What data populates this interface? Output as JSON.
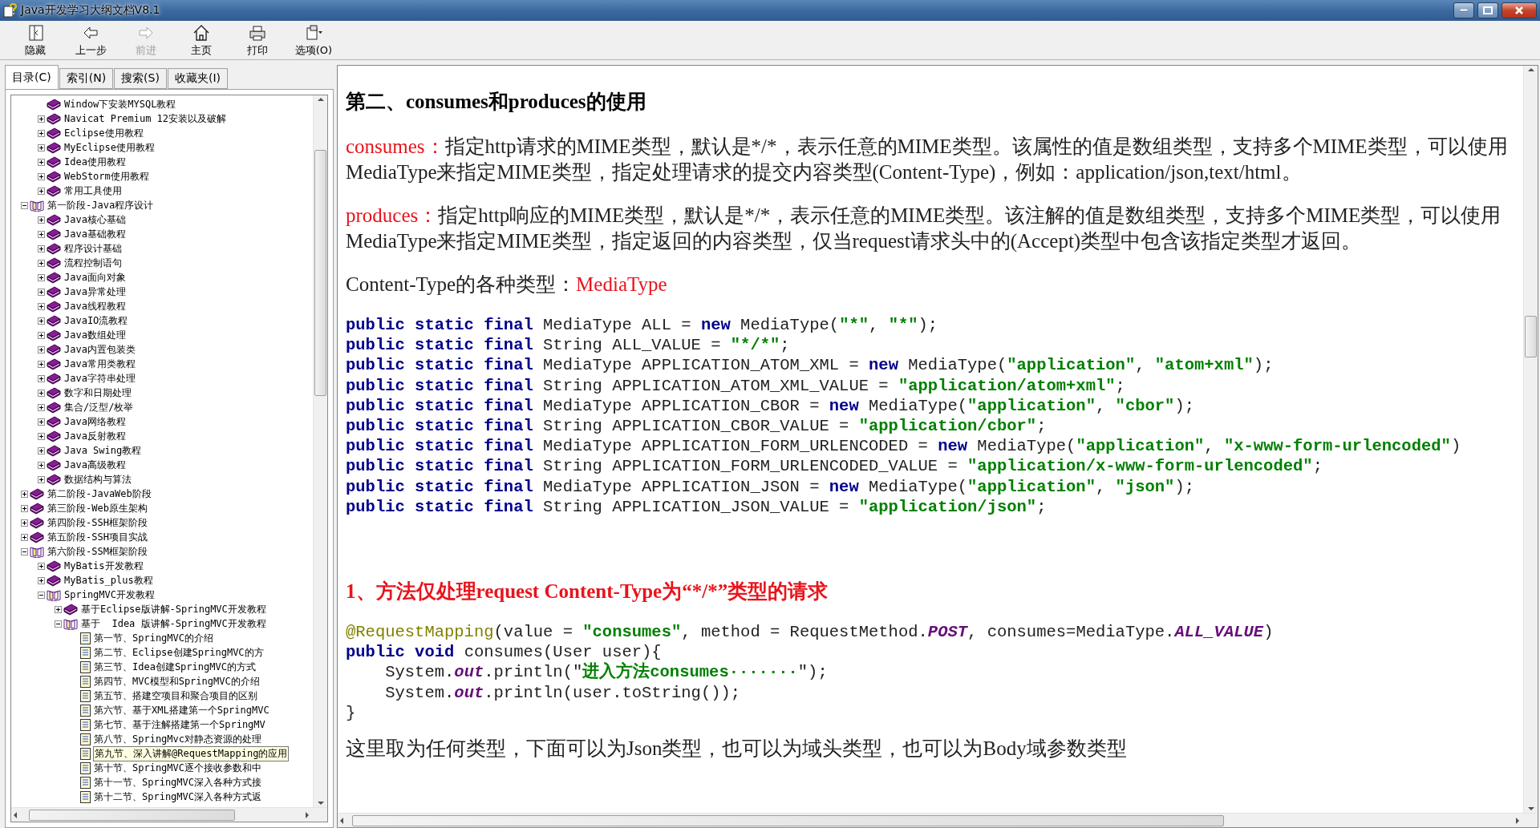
{
  "window": {
    "title": "Java开发学习大纲文档V8.1"
  },
  "toolbar": [
    {
      "label": "隐藏",
      "kind": "hide",
      "disabled": false
    },
    {
      "label": "上一步",
      "kind": "back",
      "disabled": false
    },
    {
      "label": "前进",
      "kind": "forward",
      "disabled": true
    },
    {
      "label": "主页",
      "kind": "home",
      "disabled": false
    },
    {
      "label": "打印",
      "kind": "print",
      "disabled": false
    },
    {
      "label": "选项(O)",
      "kind": "options",
      "disabled": false
    }
  ],
  "tabs": [
    {
      "label": "目录(C)",
      "selected": true
    },
    {
      "label": "索引(N)",
      "selected": false
    },
    {
      "label": "搜索(S)",
      "selected": false
    },
    {
      "label": "收藏夹(I)",
      "selected": false
    }
  ],
  "tree": [
    {
      "kind": "hidden",
      "children": [
        {
          "label": "Window下安装MYSQL教程",
          "kind": "book-single",
          "selected": false
        },
        {
          "label": "Navicat Premium 12安装以及破解",
          "kind": "book",
          "expanded": false,
          "selected": false
        },
        {
          "label": "Eclipse使用教程",
          "kind": "book",
          "expanded": false,
          "selected": false
        },
        {
          "label": "MyEclipse使用教程",
          "kind": "book",
          "expanded": false,
          "selected": false
        },
        {
          "label": "Idea使用教程",
          "kind": "book",
          "expanded": false,
          "selected": false
        },
        {
          "label": "WebStorm使用教程",
          "kind": "book",
          "expanded": false,
          "selected": false
        },
        {
          "label": "常用工具使用",
          "kind": "book",
          "expanded": false,
          "selected": false
        }
      ]
    },
    {
      "label": "第一阶段-Java程序设计",
      "kind": "book",
      "expanded": true,
      "selected": false,
      "children": [
        {
          "label": "Java核心基础",
          "kind": "book",
          "expanded": false,
          "selected": false
        },
        {
          "label": "Java基础教程",
          "kind": "book",
          "expanded": false,
          "selected": false
        },
        {
          "label": "程序设计基础",
          "kind": "book",
          "expanded": false,
          "selected": false
        },
        {
          "label": "流程控制语句",
          "kind": "book",
          "expanded": false,
          "selected": false
        },
        {
          "label": "Java面向对象",
          "kind": "book",
          "expanded": false,
          "selected": false
        },
        {
          "label": "Java异常处理",
          "kind": "book",
          "expanded": false,
          "selected": false
        },
        {
          "label": "Java线程教程",
          "kind": "book",
          "expanded": false,
          "selected": false
        },
        {
          "label": "JavaIO流教程",
          "kind": "book",
          "expanded": false,
          "selected": false
        },
        {
          "label": "Java数组处理",
          "kind": "book",
          "expanded": false,
          "selected": false
        },
        {
          "label": "Java内置包装类",
          "kind": "book",
          "expanded": false,
          "selected": false
        },
        {
          "label": "Java常用类教程",
          "kind": "book",
          "expanded": false,
          "selected": false
        },
        {
          "label": "Java字符串处理",
          "kind": "book",
          "expanded": false,
          "selected": false
        },
        {
          "label": "数字和日期处理",
          "kind": "book",
          "expanded": false,
          "selected": false
        },
        {
          "label": "集合/泛型/枚举",
          "kind": "book",
          "expanded": false,
          "selected": false
        },
        {
          "label": "Java网络教程",
          "kind": "book",
          "expanded": false,
          "selected": false
        },
        {
          "label": "Java反射教程",
          "kind": "book",
          "expanded": false,
          "selected": false
        },
        {
          "label": "Java Swing教程",
          "kind": "book",
          "expanded": false,
          "selected": false
        },
        {
          "label": "Java高级教程",
          "kind": "book",
          "expanded": false,
          "selected": false
        },
        {
          "label": "数据结构与算法",
          "kind": "book",
          "expanded": false,
          "selected": false
        }
      ]
    },
    {
      "label": "第二阶段-JavaWeb阶段",
      "kind": "book",
      "expanded": false,
      "selected": false
    },
    {
      "label": "第三阶段-Web原生架构",
      "kind": "book",
      "expanded": false,
      "selected": false
    },
    {
      "label": "第四阶段-SSH框架阶段",
      "kind": "book",
      "expanded": false,
      "selected": false
    },
    {
      "label": "第五阶段-SSH项目实战",
      "kind": "book",
      "expanded": false,
      "selected": false
    },
    {
      "label": "第六阶段-SSM框架阶段",
      "kind": "book",
      "expanded": true,
      "selected": false,
      "children": [
        {
          "label": "MyBatis开发教程",
          "kind": "book",
          "expanded": false,
          "selected": false
        },
        {
          "label": "MyBatis_plus教程",
          "kind": "book",
          "expanded": false,
          "selected": false
        },
        {
          "label": "SpringMVC开发教程",
          "kind": "book",
          "expanded": true,
          "selected": false,
          "children": [
            {
              "label": "基于Eclipse版讲解-SpringMVC开发教程",
              "kind": "book",
              "expanded": false,
              "selected": false
            },
            {
              "label": "基于  Idea 版讲解-SpringMVC开发教程",
              "kind": "book",
              "expanded": true,
              "selected": false,
              "children": [
                {
                  "label": "第一节、SpringMVC的介绍",
                  "kind": "page",
                  "selected": false
                },
                {
                  "label": "第二节、Eclipse创建SpringMVC的方",
                  "kind": "page",
                  "selected": false
                },
                {
                  "label": "第三节、Idea创建SpringMVC的方式",
                  "kind": "page",
                  "selected": false
                },
                {
                  "label": "第四节、MVC模型和SpringMVC的介绍",
                  "kind": "page",
                  "selected": false
                },
                {
                  "label": "第五节、搭建空项目和聚合项目的区别",
                  "kind": "page",
                  "selected": false
                },
                {
                  "label": "第六节、基于XML搭建第一个SpringMVC",
                  "kind": "page",
                  "selected": false
                },
                {
                  "label": "第七节、基于注解搭建第一个SpringMV",
                  "kind": "page",
                  "selected": false
                },
                {
                  "label": "第八节、SpringMvc对静态资源的处理",
                  "kind": "page",
                  "selected": false
                },
                {
                  "label": "第九节、深入讲解@RequestMapping的应用",
                  "kind": "page",
                  "selected": true
                },
                {
                  "label": "第十节、SpringMVC逐个接收参数和中",
                  "kind": "page",
                  "selected": false
                },
                {
                  "label": "第十一节、SpringMVC深入各种方式接",
                  "kind": "page",
                  "selected": false
                },
                {
                  "label": "第十二节、SpringMVC深入各种方式返",
                  "kind": "page",
                  "selected": false
                }
              ]
            }
          ]
        }
      ]
    }
  ],
  "content": [
    {
      "kind": "heading",
      "segments": [
        {
          "kind": "plain",
          "text": "第二、consumes和produces的使用"
        }
      ]
    },
    {
      "kind": "paragraph",
      "segments": [
        {
          "kind": "term",
          "text": "consumes："
        },
        {
          "kind": "plain",
          "text": "指定http请求的MIME类型，默认是*/*，表示任意的MIME类型。该属性的值是数组类型，支持多个MIME类型，可以使用MediaType来指定MIME类型，指定处理请求的提交内容类型(Content-Type)，例如：application/json,text/html。"
        }
      ]
    },
    {
      "kind": "paragraph",
      "segments": [
        {
          "kind": "term",
          "text": "produces："
        },
        {
          "kind": "plain",
          "text": "指定http响应的MIME类型，默认是*/*，表示任意的MIME类型。该注解的值是数组类型，支持多个MIME类型，可以使用MediaType来指定MIME类型，指定返回的内容类型，仅当request请求头中的(Accept)类型中包含该指定类型才返回。"
        }
      ]
    },
    {
      "kind": "paragraph",
      "segments": [
        {
          "kind": "plain",
          "text": "Content-Type的各种类型："
        },
        {
          "kind": "term",
          "text": "MediaType"
        }
      ]
    },
    {
      "kind": "code",
      "lines": [
        [
          {
            "kind": "kw",
            "text": "public static final"
          },
          {
            "kind": "plain",
            "text": " MediaType ALL = "
          },
          {
            "kind": "kw",
            "text": "new"
          },
          {
            "kind": "plain",
            "text": " MediaType("
          },
          {
            "kind": "str",
            "text": "\"*\""
          },
          {
            "kind": "plain",
            "text": ", "
          },
          {
            "kind": "str",
            "text": "\"*\""
          },
          {
            "kind": "plain",
            "text": ");"
          }
        ],
        [
          {
            "kind": "kw",
            "text": "public static final"
          },
          {
            "kind": "plain",
            "text": " String ALL_VALUE = "
          },
          {
            "kind": "str",
            "text": "\"*/*\""
          },
          {
            "kind": "plain",
            "text": ";"
          }
        ],
        [
          {
            "kind": "kw",
            "text": "public static final"
          },
          {
            "kind": "plain",
            "text": " MediaType APPLICATION_ATOM_XML = "
          },
          {
            "kind": "kw",
            "text": "new"
          },
          {
            "kind": "plain",
            "text": " MediaType("
          },
          {
            "kind": "str",
            "text": "\"application\""
          },
          {
            "kind": "plain",
            "text": ", "
          },
          {
            "kind": "str",
            "text": "\"atom+xml\""
          },
          {
            "kind": "plain",
            "text": ");"
          }
        ],
        [
          {
            "kind": "kw",
            "text": "public static final"
          },
          {
            "kind": "plain",
            "text": " String APPLICATION_ATOM_XML_VALUE = "
          },
          {
            "kind": "str",
            "text": "\"application/atom+xml\""
          },
          {
            "kind": "plain",
            "text": ";"
          }
        ],
        [
          {
            "kind": "kw",
            "text": "public static final"
          },
          {
            "kind": "plain",
            "text": " MediaType APPLICATION_CBOR = "
          },
          {
            "kind": "kw",
            "text": "new"
          },
          {
            "kind": "plain",
            "text": " MediaType("
          },
          {
            "kind": "str",
            "text": "\"application\""
          },
          {
            "kind": "plain",
            "text": ", "
          },
          {
            "kind": "str",
            "text": "\"cbor\""
          },
          {
            "kind": "plain",
            "text": ");"
          }
        ],
        [
          {
            "kind": "kw",
            "text": "public static final"
          },
          {
            "kind": "plain",
            "text": " String APPLICATION_CBOR_VALUE = "
          },
          {
            "kind": "str",
            "text": "\"application/cbor\""
          },
          {
            "kind": "plain",
            "text": ";"
          }
        ],
        [
          {
            "kind": "kw",
            "text": "public static final"
          },
          {
            "kind": "plain",
            "text": " MediaType APPLICATION_FORM_URLENCODED = "
          },
          {
            "kind": "kw",
            "text": "new"
          },
          {
            "kind": "plain",
            "text": " MediaType("
          },
          {
            "kind": "str",
            "text": "\"application\""
          },
          {
            "kind": "plain",
            "text": ", "
          },
          {
            "kind": "str",
            "text": "\"x-www-form-urlencoded\""
          },
          {
            "kind": "plain",
            "text": ")"
          }
        ],
        [
          {
            "kind": "kw",
            "text": "public static final"
          },
          {
            "kind": "plain",
            "text": " String APPLICATION_FORM_URLENCODED_VALUE = "
          },
          {
            "kind": "str",
            "text": "\"application/x-www-form-urlencoded\""
          },
          {
            "kind": "plain",
            "text": ";"
          }
        ],
        [
          {
            "kind": "kw",
            "text": "public static final"
          },
          {
            "kind": "plain",
            "text": " MediaType APPLICATION_JSON = "
          },
          {
            "kind": "kw",
            "text": "new"
          },
          {
            "kind": "plain",
            "text": " MediaType("
          },
          {
            "kind": "str",
            "text": "\"application\""
          },
          {
            "kind": "plain",
            "text": ", "
          },
          {
            "kind": "str",
            "text": "\"json\""
          },
          {
            "kind": "plain",
            "text": ");"
          }
        ],
        [
          {
            "kind": "kw",
            "text": "public static final"
          },
          {
            "kind": "plain",
            "text": " String APPLICATION_JSON_VALUE = "
          },
          {
            "kind": "str",
            "text": "\"application/json\""
          },
          {
            "kind": "plain",
            "text": ";"
          }
        ]
      ]
    },
    {
      "kind": "section",
      "segments": [
        {
          "kind": "plain",
          "text": "1、方法仅处理request Content-Type为“*/*”类型的请求"
        }
      ]
    },
    {
      "kind": "code",
      "lines": [
        [
          {
            "kind": "anno",
            "text": "@RequestMapping"
          },
          {
            "kind": "plain",
            "text": "(value = "
          },
          {
            "kind": "str",
            "text": "\"consumes\""
          },
          {
            "kind": "plain",
            "text": ", method = RequestMethod."
          },
          {
            "kind": "field",
            "text": "POST"
          },
          {
            "kind": "plain",
            "text": ", consumes=MediaType."
          },
          {
            "kind": "field",
            "text": "ALL_VALUE"
          },
          {
            "kind": "plain",
            "text": ")"
          }
        ],
        [
          {
            "kind": "kw",
            "text": "public void"
          },
          {
            "kind": "plain",
            "text": " consumes(User user){"
          }
        ],
        [
          {
            "kind": "plain",
            "text": "    System."
          },
          {
            "kind": "field",
            "text": "out"
          },
          {
            "kind": "plain",
            "text": ".println(\""
          },
          {
            "kind": "str",
            "text": "进入方法consumes·······"
          },
          {
            "kind": "plain",
            "text": "\");"
          }
        ],
        [
          {
            "kind": "plain",
            "text": "    System."
          },
          {
            "kind": "field",
            "text": "out"
          },
          {
            "kind": "plain",
            "text": ".println(user.toString());"
          }
        ],
        [
          {
            "kind": "plain",
            "text": "}"
          }
        ]
      ]
    },
    {
      "kind": "paragraph",
      "segments": [
        {
          "kind": "plain",
          "text": "这里取为任何类型，下面可以为Json类型，也可以为域头类型，也可以为Body域参数类型"
        }
      ]
    }
  ]
}
